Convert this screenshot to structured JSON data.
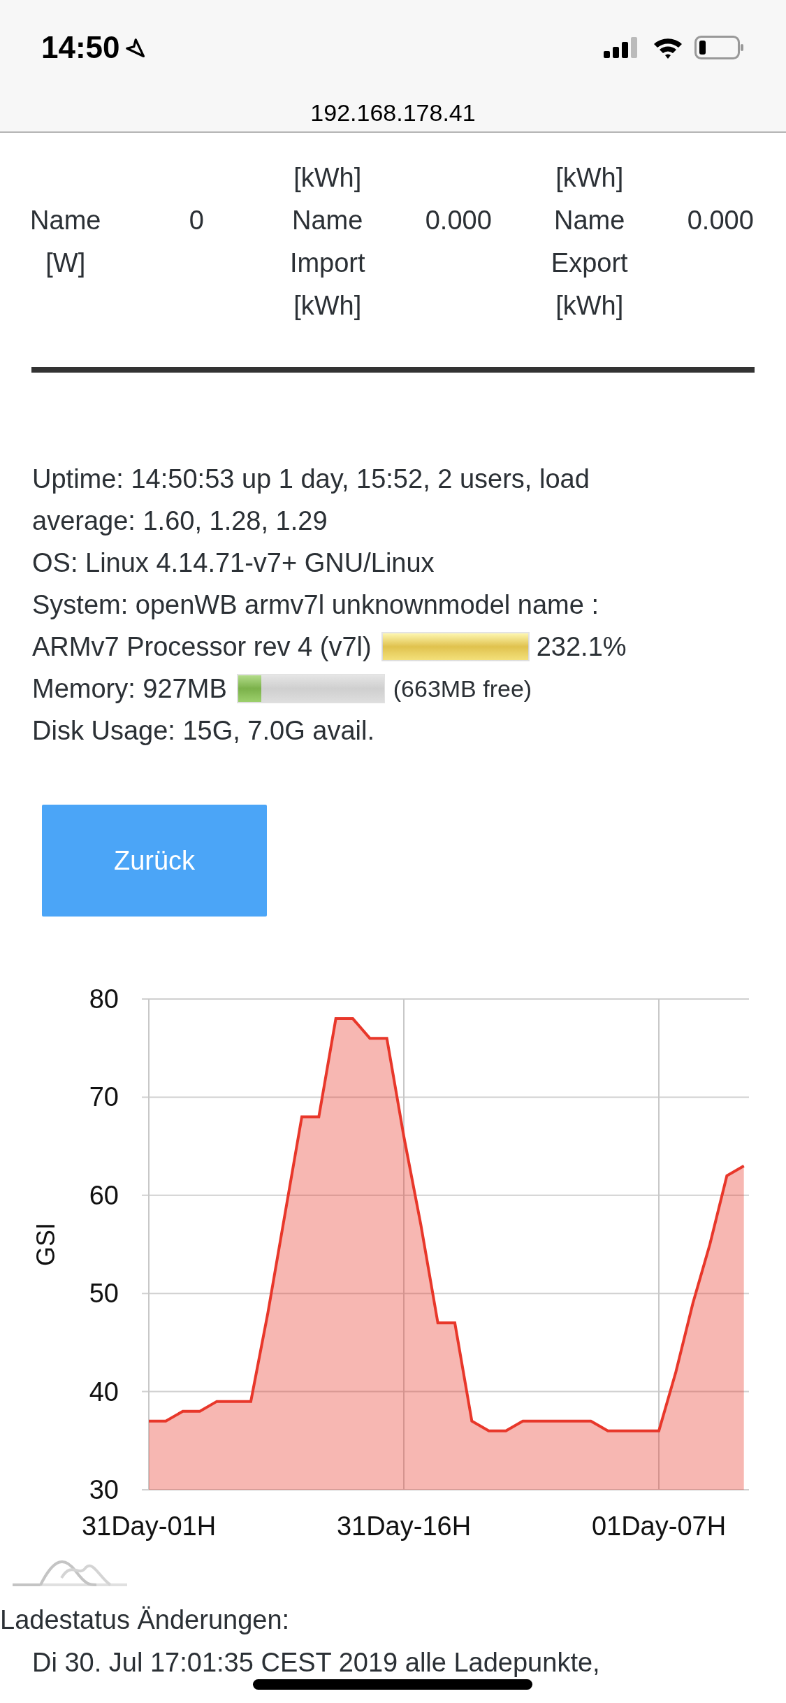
{
  "status_bar": {
    "time": "14:50"
  },
  "address_bar": {
    "url": "192.168.178.41"
  },
  "table": {
    "rows": [
      [
        null,
        null,
        "[kWh]",
        null,
        "[kWh]",
        null
      ],
      [
        "Name\n[W]",
        "0",
        "Name\nImport\n[kWh]",
        "0.000",
        "Name\nExport\n[kWh]",
        "0.000"
      ]
    ]
  },
  "system_info": {
    "uptime": "Uptime: 14:50:53 up 1 day, 15:52, 2 users, load average: 1.60, 1.28, 1.29",
    "os": "OS: Linux 4.14.71-v7+ GNU/Linux",
    "system": "System: openWB armv7l unknownmodel name :",
    "cpu": {
      "label": "ARMv7 Processor rev 4 (v7l)",
      "level": 1,
      "reading": "232.1%"
    },
    "memory": {
      "label": "Memory: 927MB",
      "level": 0.16,
      "reading": "(663MB free)"
    },
    "disk": "Disk Usage: 15G, 7.0G avail."
  },
  "back_button": "Zurück",
  "chart": {
    "chart_data": {
      "type": "area",
      "ylabel": "GSI",
      "categories": [
        "31Day-01H",
        null,
        null,
        null,
        null,
        null,
        null,
        null,
        null,
        null,
        null,
        null,
        null,
        null,
        null,
        "31Day-16H",
        null,
        null,
        null,
        null,
        null,
        null,
        null,
        null,
        null,
        null,
        null,
        null,
        null,
        null,
        "01Day-07H",
        null,
        null,
        null,
        null,
        null
      ],
      "series": [
        {
          "color": "#e8372a",
          "values": [
            37,
            37,
            38,
            38,
            39,
            39,
            39,
            48,
            58,
            68,
            68,
            78,
            78,
            76,
            76,
            66,
            57,
            47,
            47,
            37,
            36,
            36,
            37,
            37,
            37,
            37,
            37,
            36,
            36,
            36,
            36,
            42,
            49,
            55,
            62,
            63
          ]
        }
      ],
      "ylim": [
        30,
        80
      ],
      "grid": true,
      "yticks": [
        30,
        40,
        50,
        60,
        70,
        80
      ]
    }
  },
  "log": {
    "title": "Ladestatus Änderungen:",
    "entries": [
      "Di 30. Jul 17:01:35 CEST 2019 alle Ladepunkte,"
    ]
  }
}
